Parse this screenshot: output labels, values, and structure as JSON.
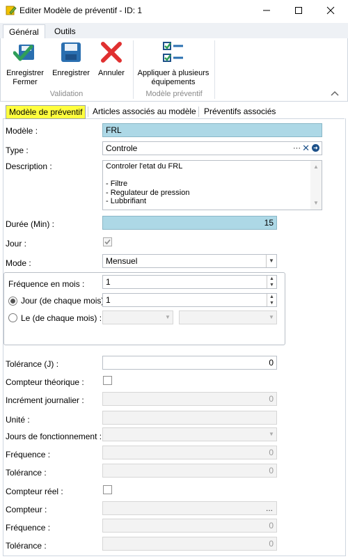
{
  "window": {
    "title": "Editer Modèle de préventif - ID: 1",
    "minimize_icon": "minimize-icon",
    "maximize_icon": "maximize-icon",
    "close_icon": "close-icon"
  },
  "ribbon": {
    "tabs": [
      {
        "label": "Général",
        "active": true
      },
      {
        "label": "Outils",
        "active": false
      }
    ],
    "buttons": {
      "save_close": {
        "line1": "Enregistrer",
        "line2": "Fermer",
        "icon": "save-close-icon"
      },
      "save": {
        "label": "Enregistrer",
        "icon": "save-icon"
      },
      "cancel": {
        "label": "Annuler",
        "icon": "cancel-icon"
      },
      "apply_multi": {
        "line1": "Appliquer à plusieurs",
        "line2": "équipements",
        "icon": "checklist-icon"
      }
    },
    "groups": {
      "validation": "Validation",
      "modele": "Modèle préventif"
    },
    "collapse_icon": "chevron-up-icon"
  },
  "form_tabs": [
    {
      "label": "Modèle de préventif",
      "active": true
    },
    {
      "label": "Articles associés au modèle",
      "active": false
    },
    {
      "label": "Préventifs associés",
      "active": false
    }
  ],
  "form": {
    "modele": {
      "label": "Modèle :",
      "value": "FRL"
    },
    "type": {
      "label": "Type :",
      "value": "Controle"
    },
    "description": {
      "label": "Description :",
      "lines": [
        "Controler l'etat du FRL",
        "",
        "- Filtre",
        "- Regulateur de pression",
        "- Lubbrifiant"
      ]
    },
    "duree": {
      "label": "Durée (Min) :",
      "value": "15"
    },
    "jour": {
      "label": "Jour :",
      "checked": true
    },
    "mode": {
      "label": "Mode :",
      "value": "Mensuel"
    },
    "frequence_mois": {
      "label": "Fréquence en mois :",
      "value": "1"
    },
    "jour_chaque_mois": {
      "label": "Jour (de chaque mois) :",
      "value": "1",
      "selected": true
    },
    "le_chaque_mois": {
      "label": "Le (de chaque mois) :",
      "selected": false
    },
    "tolerance_j": {
      "label": "Tolérance (J) :",
      "value": "0"
    },
    "compteur_theorique": {
      "label": "Compteur théorique :",
      "checked": false
    },
    "increment_journalier": {
      "label": "Incrément journalier :",
      "value": "0"
    },
    "unite": {
      "label": "Unité :",
      "value": ""
    },
    "jours_fonctionnement": {
      "label": "Jours de fonctionnement :",
      "value": ""
    },
    "frequence_1": {
      "label": "Fréquence :",
      "value": "0"
    },
    "tolerance_1": {
      "label": "Tolérance :",
      "value": "0"
    },
    "compteur_reel": {
      "label": "Compteur réel :",
      "checked": false
    },
    "compteur": {
      "label": "Compteur :",
      "button": "..."
    },
    "frequence_2": {
      "label": "Fréquence :",
      "value": "0"
    },
    "tolerance_2": {
      "label": "Tolérance :",
      "value": "0"
    }
  },
  "colors": {
    "highlight_blue": "#add8e6",
    "active_tab_yellow": "#fffe3e",
    "save_green": "#2f9e5a",
    "cancel_red": "#e03030",
    "ribbon_blue": "#2a6fb0"
  }
}
